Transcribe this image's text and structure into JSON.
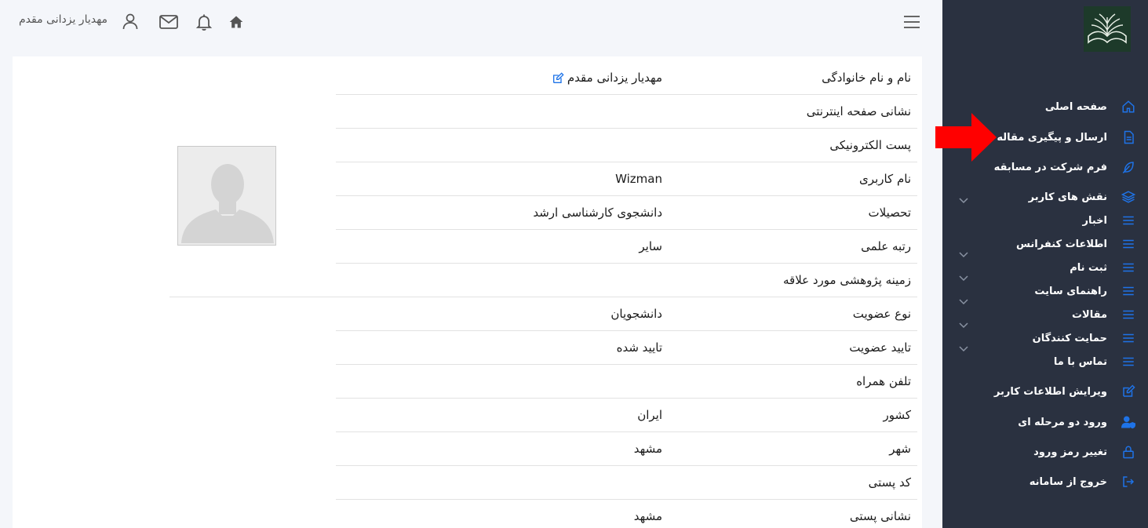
{
  "header": {
    "user_name": "مهدیار یزدانی مقدم",
    "icons": [
      "menu-icon",
      "home-icon",
      "bell-icon",
      "mail-icon",
      "user-icon"
    ]
  },
  "sidebar": {
    "items": [
      {
        "label": "صفحه اصلی",
        "icon": "home-icon",
        "has_submenu": false
      },
      {
        "label": "ارسال و پیگیری مقاله",
        "icon": "document-icon",
        "has_submenu": false
      },
      {
        "label": "فرم شرکت در مسابقه",
        "icon": "feather-icon",
        "has_submenu": false
      },
      {
        "label": "نقش های کاربر",
        "icon": "layers-icon",
        "has_submenu": true
      },
      {
        "label": "اخبار",
        "icon": "list-icon",
        "has_submenu": false
      },
      {
        "label": "اطلاعات کنفرانس",
        "icon": "list-icon",
        "has_submenu": true
      },
      {
        "label": "ثبت نام",
        "icon": "list-icon",
        "has_submenu": true
      },
      {
        "label": "راهنمای سایت",
        "icon": "list-icon",
        "has_submenu": true
      },
      {
        "label": "مقالات",
        "icon": "list-icon",
        "has_submenu": true
      },
      {
        "label": "حمایت کنندگان",
        "icon": "list-icon",
        "has_submenu": true
      },
      {
        "label": "تماس با ما",
        "icon": "list-icon",
        "has_submenu": false
      },
      {
        "label": "ویرایش اطلاعات کاربر",
        "icon": "edit-icon",
        "has_submenu": false
      },
      {
        "label": "ورود دو مرحله ای",
        "icon": "user-shield-icon",
        "has_submenu": false
      },
      {
        "label": "تغییر رمز ورود",
        "icon": "lock-icon",
        "has_submenu": false
      },
      {
        "label": "خروج از سامانه",
        "icon": "logout-icon",
        "has_submenu": false
      }
    ]
  },
  "profile": {
    "rows": [
      {
        "label": "نام و نام خانوادگی",
        "value": "مهدیار یزدانی مقدم"
      },
      {
        "label": "نشانی صفحه اینترنتی",
        "value": ""
      },
      {
        "label": "پست الکترونیکی",
        "value": ""
      },
      {
        "label": "نام کاربری",
        "value": "Wizman"
      },
      {
        "label": "تحصیلات",
        "value": "دانشجوی کارشناسی ارشد"
      },
      {
        "label": "رتبه علمی",
        "value": "سایر"
      },
      {
        "label": "زمینه پژوهشی مورد علاقه",
        "value": ""
      },
      {
        "label": "نوع عضویت",
        "value": "دانشجویان"
      },
      {
        "label": "تایید عضویت",
        "value": "تایید شده"
      },
      {
        "label": "تلفن همراه",
        "value": ""
      },
      {
        "label": "کشور",
        "value": "ایران"
      },
      {
        "label": "شهر",
        "value": "مشهد"
      },
      {
        "label": "کد پستی",
        "value": ""
      },
      {
        "label": "نشانی پستی",
        "value": "مشهد"
      }
    ]
  },
  "colors": {
    "sidebar_bg": "#2a3140",
    "accent": "#1e73e8",
    "arrow": "#ff0000"
  }
}
